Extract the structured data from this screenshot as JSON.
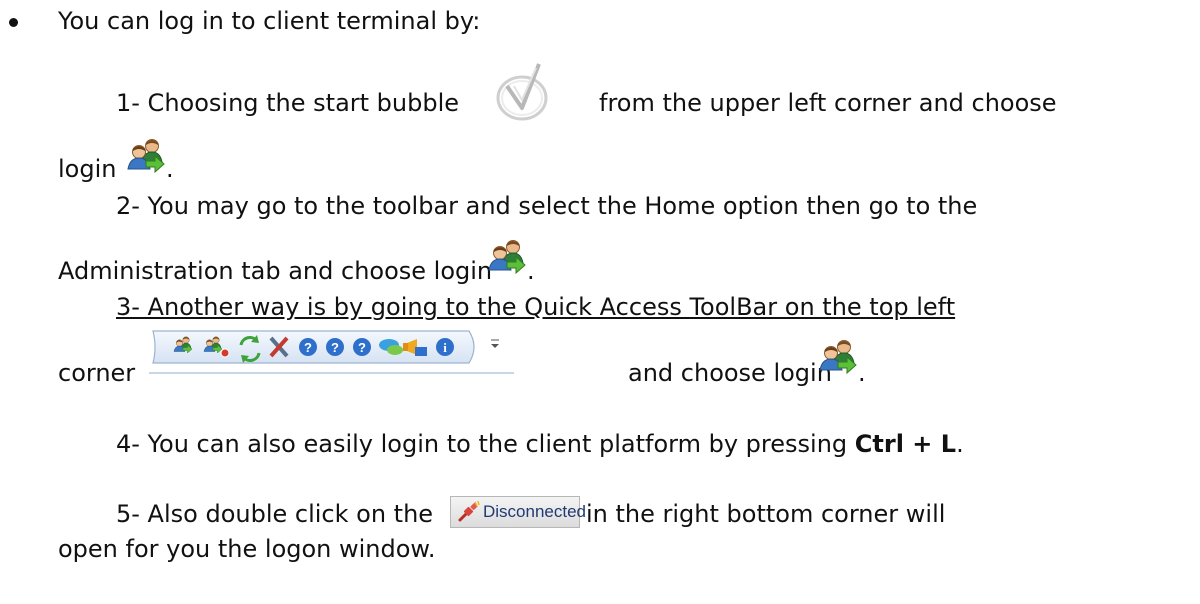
{
  "intro": "You can log in to client terminal by:",
  "step1": {
    "text_a": "1- Choosing the start bubble",
    "text_b": "from the upper left corner and choose",
    "text_c": "login",
    "text_d": "."
  },
  "step2": {
    "text_a": "2- You may go to the toolbar and select the Home option then go to the",
    "text_b": "Administration tab and choose login",
    "text_c": "."
  },
  "step3": {
    "text_a": "3- Another way is by going to the Quick Access ToolBar on the top left",
    "text_b": "corner",
    "text_c": "and choose login",
    "text_d": "."
  },
  "step4": {
    "text_a": "4- You can also easily login to the client platform by pressing",
    "shortcut": "Ctrl + L",
    "text_b": "."
  },
  "step5": {
    "text_a": "5- Also double click on the",
    "text_b": "in the right bottom corner will",
    "text_c": "open for you the logon window."
  },
  "status_badge": {
    "label": "Disconnected"
  },
  "icons": {
    "start_bubble": "start-bubble-icon",
    "login": "login-users-icon",
    "quick_access_toolbar": [
      "login-icon",
      "logout-icon",
      "refresh-icon",
      "tools-icon",
      "help-icon",
      "help-icon",
      "help-icon",
      "chat-icon",
      "announcement-icon",
      "info-icon",
      "toolbar-dropdown-icon"
    ],
    "disconnected": "disconnected-plug-icon"
  }
}
